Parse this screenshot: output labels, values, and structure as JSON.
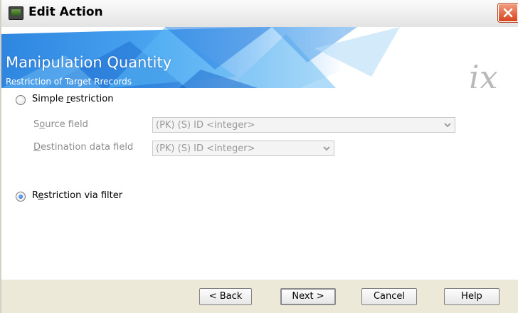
{
  "window": {
    "title": "Edit Action",
    "icon": "app-icon",
    "close_icon": "close-icon"
  },
  "header": {
    "title": "Manipulation Quantity",
    "subtitle": "Restriction of Target Rrecords",
    "logo_text": "ix"
  },
  "options": {
    "simple_restriction": {
      "label_prefix": "Simple ",
      "label_accel": "r",
      "label_suffix": "estriction",
      "checked": false
    },
    "source_field": {
      "label_prefix": "S",
      "label_accel": "o",
      "label_suffix": "urce field",
      "value": "(PK) (S) ID <integer>",
      "enabled": false
    },
    "destination_field": {
      "label_prefix": "",
      "label_accel": "D",
      "label_suffix": "estination data field",
      "value": "(PK) (S) ID <integer>",
      "enabled": false
    },
    "filter_restriction": {
      "label_prefix": "R",
      "label_accel": "e",
      "label_suffix": "striction via filter",
      "checked": true
    }
  },
  "buttons": {
    "back": "< Back",
    "next": "Next >",
    "cancel": "Cancel",
    "help": "Help"
  },
  "colors": {
    "banner_blue": "#3a8fe6",
    "radio_selected": "#1c5fc8",
    "close_red": "#d6451f"
  }
}
